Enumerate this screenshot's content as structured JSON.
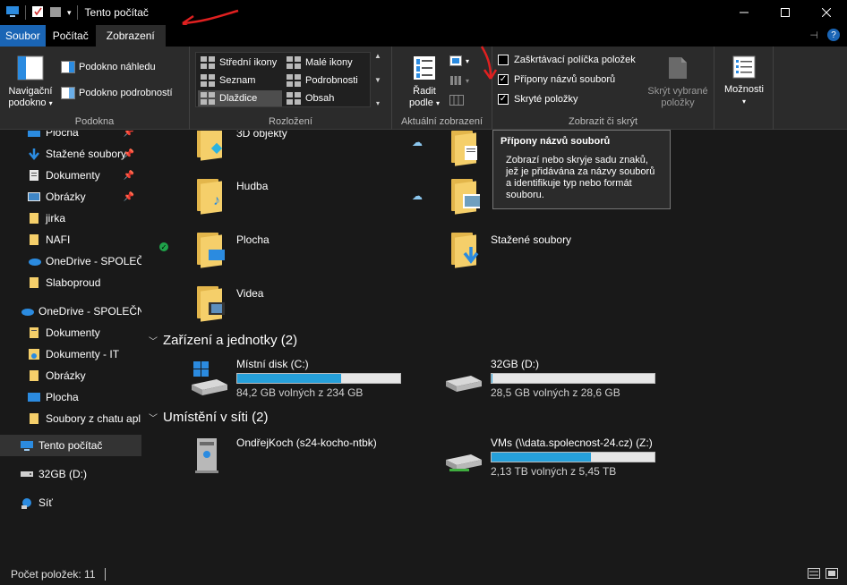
{
  "window": {
    "title": "Tento počítač"
  },
  "tabs": {
    "file": "Soubor",
    "computer": "Počítač",
    "view": "Zobrazení"
  },
  "ribbon": {
    "panes": {
      "nav_pane_line1": "Navigační",
      "nav_pane_line2": "podokno",
      "preview_pane": "Podokno náhledu",
      "details_pane": "Podokno podrobností",
      "label": "Podokna"
    },
    "layout": {
      "medium_icons": "Střední ikony",
      "small_icons": "Malé ikony",
      "list": "Seznam",
      "details": "Podrobnosti",
      "tiles": "Dlaždice",
      "content": "Obsah",
      "label": "Rozložení"
    },
    "current_view": {
      "sort_line1": "Řadit",
      "sort_line2": "podle",
      "label": "Aktuální zobrazení"
    },
    "show_hide": {
      "item_checkboxes": "Zaškrtávací políčka položek",
      "item_checkboxes_checked": false,
      "file_extensions": "Přípony názvů souborů",
      "file_extensions_checked": true,
      "hidden_items": "Skryté položky",
      "hidden_items_checked": true,
      "hide_selected_line1": "Skrýt vybrané",
      "hide_selected_line2": "položky",
      "label": "Zobrazit či skrýt"
    },
    "options": {
      "label": "Možnosti"
    }
  },
  "nav": {
    "items": [
      {
        "label": "Plocha",
        "icon": "desktop-icon",
        "pinned": true
      },
      {
        "label": "Stažené soubory",
        "icon": "download-icon",
        "pinned": true
      },
      {
        "label": "Dokumenty",
        "icon": "document-icon",
        "pinned": true
      },
      {
        "label": "Obrázky",
        "icon": "pictures-icon",
        "pinned": true
      },
      {
        "label": "jirka",
        "icon": "folder-icon",
        "pinned": false
      },
      {
        "label": "NAFI",
        "icon": "folder-icon",
        "pinned": false
      },
      {
        "label": "OneDrive - SPOLEČ",
        "icon": "onedrive-icon",
        "pinned": false
      },
      {
        "label": "Slaboproud",
        "icon": "folder-icon",
        "pinned": false
      },
      {
        "label": "OneDrive - SPOLEČN",
        "icon": "onedrive-icon",
        "pinned": false
      },
      {
        "label": "Dokumenty",
        "icon": "document-icon",
        "pinned": false
      },
      {
        "label": "Dokumenty - IT",
        "icon": "shared-folder-icon",
        "pinned": false
      },
      {
        "label": "Obrázky",
        "icon": "pictures-icon",
        "pinned": false
      },
      {
        "label": "Plocha",
        "icon": "desktop-icon",
        "pinned": false
      },
      {
        "label": "Soubory z chatu apl",
        "icon": "folder-icon",
        "pinned": false
      },
      {
        "label": "Tento počítač",
        "icon": "this-pc-icon",
        "pinned": false
      },
      {
        "label": "32GB (D:)",
        "icon": "drive-icon",
        "pinned": false
      },
      {
        "label": "Síť",
        "icon": "network-icon",
        "pinned": false
      }
    ]
  },
  "folders": [
    {
      "label": "3D objekty"
    },
    {
      "label": "Hudba"
    },
    {
      "label": "Plocha"
    },
    {
      "label": "Videa"
    },
    {
      "label": "Stažené soubory"
    }
  ],
  "devices": {
    "header": "Zařízení a jednotky (2)",
    "items": [
      {
        "name": "Místní disk (C:)",
        "free": "84,2 GB volných z 234 GB",
        "used_fraction": 0.64
      },
      {
        "name": "32GB (D:)",
        "free": "28,5 GB volných z 28,6 GB",
        "used_fraction": 0.004
      }
    ]
  },
  "network": {
    "header": "Umístění v síti (2)",
    "items": [
      {
        "name": "OndřejKoch (s24-kocho-ntbk)"
      },
      {
        "name": "VMs (\\\\data.spolecnost-24.cz) (Z:)",
        "free": "2,13 TB volných z 5,45 TB",
        "used_fraction": 0.61
      }
    ]
  },
  "tooltip": {
    "title": "Přípony názvů souborů",
    "body": "Zobrazí nebo skryje sadu znaků, jež je přidávána za názvy souborů a identifikuje typ nebo formát souboru."
  },
  "status": {
    "count": "Počet položek: 11"
  },
  "colors": {
    "accent": "#1a65b5",
    "progress": "#26a0da",
    "annotation": "#e02020"
  }
}
